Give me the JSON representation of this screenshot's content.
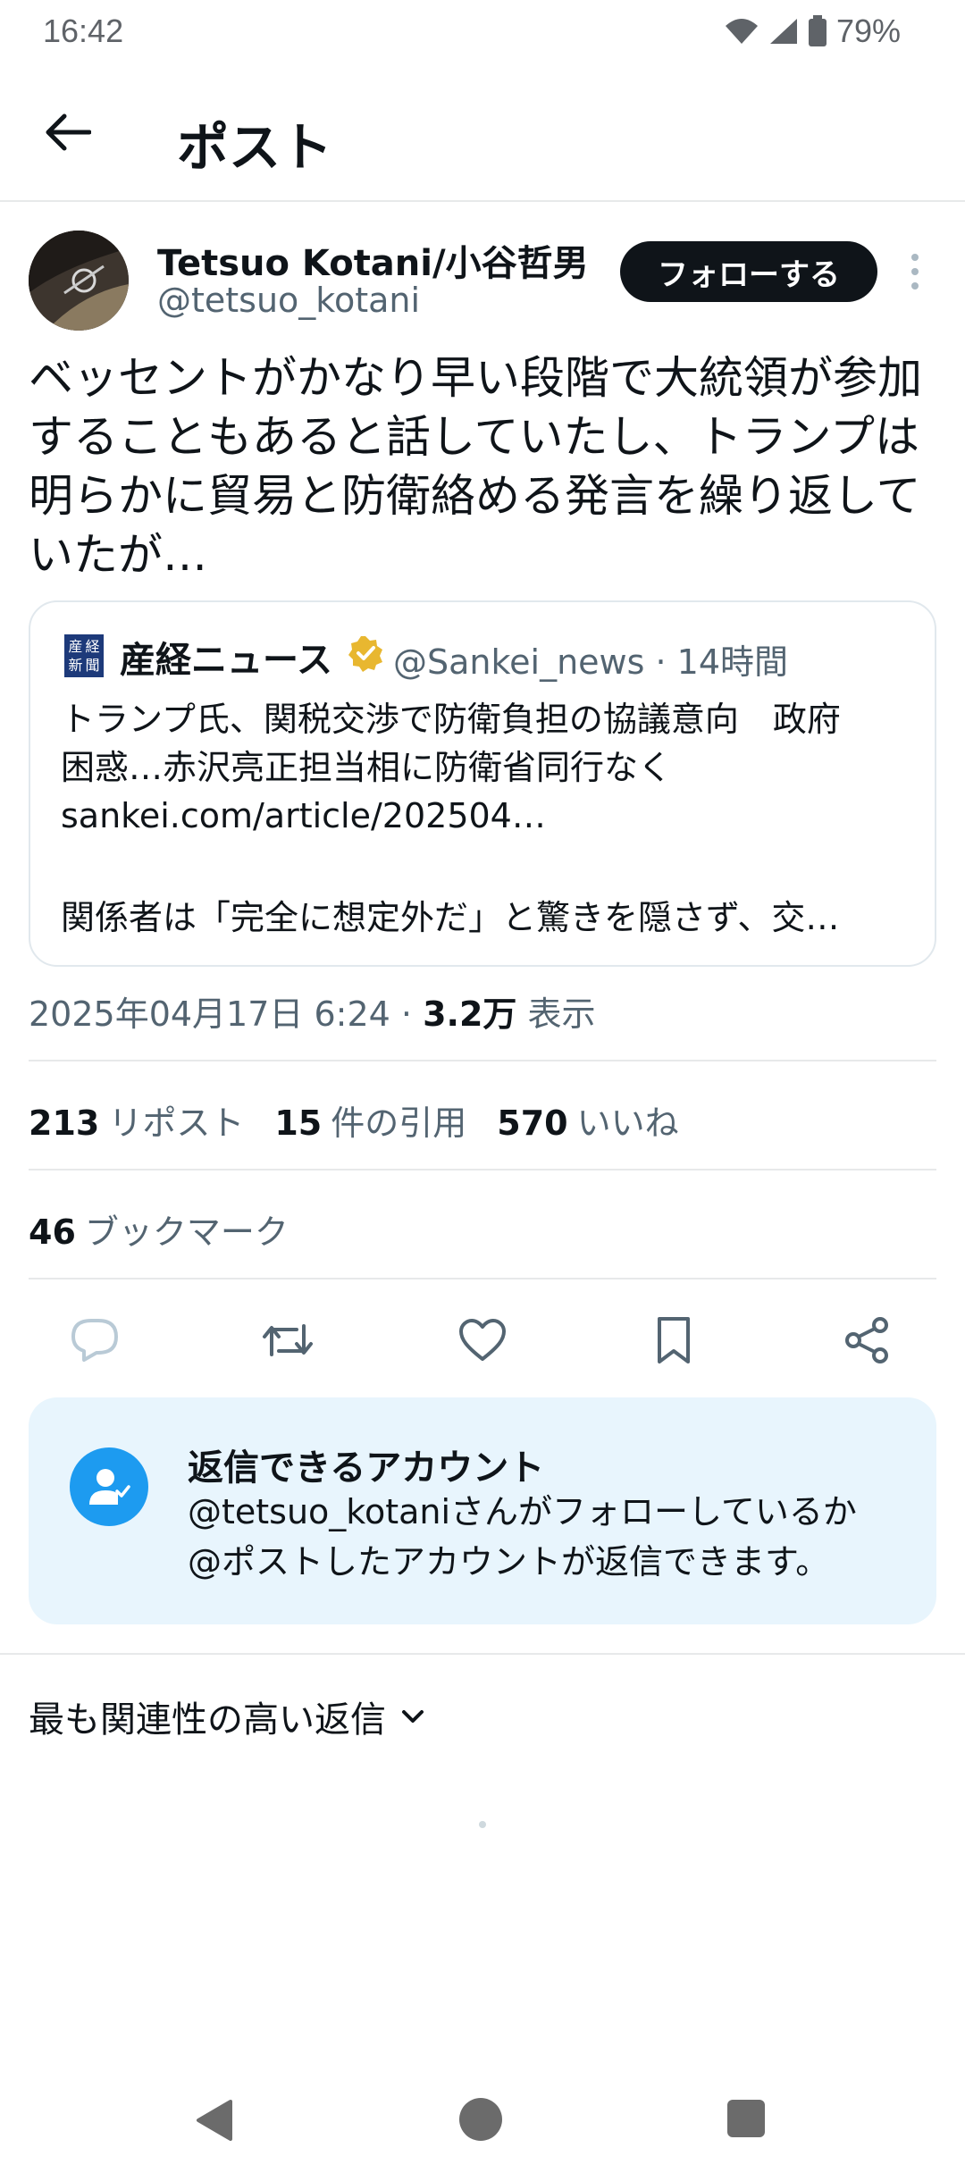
{
  "status_bar": {
    "time": "16:42",
    "battery": "79%"
  },
  "header": {
    "title": "ポスト"
  },
  "author": {
    "name": "Tetsuo Kotani/小谷哲男",
    "handle": "@tetsuo_kotani",
    "follow_label": "フォローする"
  },
  "post": {
    "text": "ベッセントがかなり早い段階で大統領が参加\nすることもあると話していたし、トランプは\n明らかに貿易と防衛絡める発言を繰り返して\nいたが…"
  },
  "quote": {
    "logo_chars": [
      "産",
      "経",
      "新",
      "聞"
    ],
    "name": "産経ニュース",
    "handle_time": "@Sankei_news · 14時間",
    "text": "トランプ氏、関税交渉で防衛負担の協議意向　政府\n困惑…赤沢亮正担当相に防衛省同行なく\nsankei.com/article/202504…",
    "extra": "関係者は「完全に想定外だ」と驚きを隠さず、交…"
  },
  "meta": {
    "datetime": "2025年04月17日 6:24 · ",
    "views": "3.2万",
    "views_label": " 表示"
  },
  "stats": {
    "reposts_count": "213",
    "reposts_label": "リポスト",
    "quotes_count": "15",
    "quotes_label": "件の引用",
    "likes_count": "570",
    "likes_label": "いいね",
    "bookmarks_count": "46",
    "bookmarks_label": "ブックマーク"
  },
  "actions": [
    "reply-icon",
    "repost-icon",
    "like-icon",
    "bookmark-icon",
    "share-icon"
  ],
  "reply_restriction": {
    "title": "返信できるアカウント",
    "body": "@tetsuo_kotaniさんがフォローしているか\n@ポストしたアカウントが返信できます。"
  },
  "sort": {
    "label": "最も関連性の高い返信"
  },
  "colors": {
    "accent": "#1d9bf0",
    "text": "#0f1419",
    "secondary": "#536471",
    "card_bg": "#e8f5fd",
    "verified": "#e8b730"
  }
}
